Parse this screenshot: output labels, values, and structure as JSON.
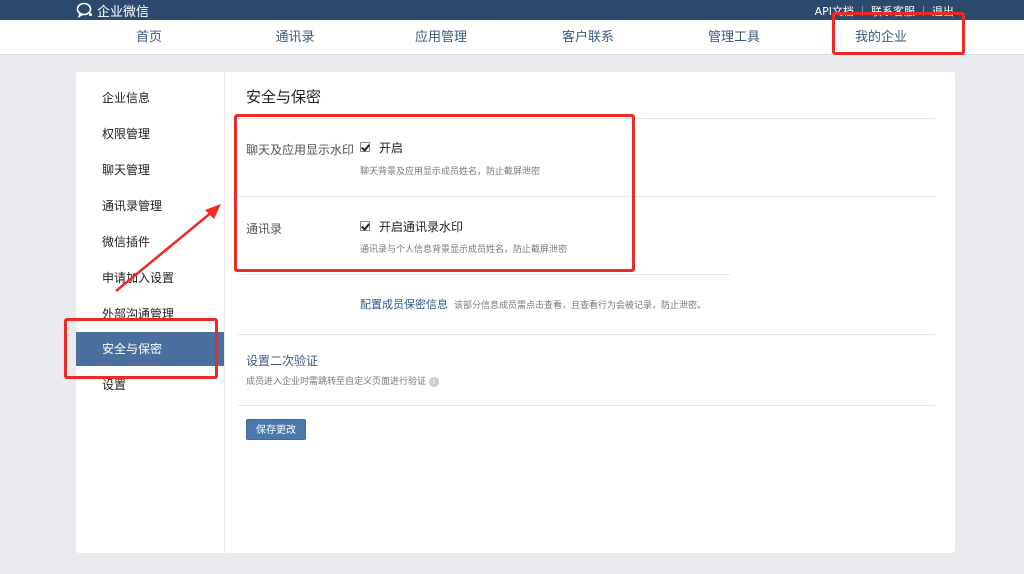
{
  "app": {
    "logo_text": "企业微信"
  },
  "top_links": [
    "API文档",
    "联系客服",
    "退出"
  ],
  "nav": [
    "首页",
    "通讯录",
    "应用管理",
    "客户联系",
    "管理工具",
    "我的企业"
  ],
  "sidebar": [
    "企业信息",
    "权限管理",
    "聊天管理",
    "通讯录管理",
    "微信插件",
    "申请加入设置",
    "外部沟通管理",
    "安全与保密",
    "设置"
  ],
  "sidebar_active": "安全与保密",
  "main": {
    "title": "安全与保密",
    "watermark_chat": {
      "label": "聊天及应用显示水印",
      "option": "开启",
      "checked": true,
      "hint": "聊天背景及应用显示成员姓名，防止截屏泄密"
    },
    "watermark_contacts": {
      "label": "通讯录",
      "option": "开启通讯录水印",
      "checked": true,
      "hint": "通讯录与个人信息背景显示成员姓名，防止截屏泄密"
    },
    "member_secret": {
      "link": "配置成员保密信息",
      "desc": "该部分信息成员需点击查看，且查看行为会被记录，防止泄密。"
    },
    "two_step": {
      "title": "设置二次验证",
      "desc": "成员进入企业时需跳转至自定义页面进行验证"
    },
    "save_label": "保存更改"
  },
  "colors": {
    "topbar": "#2c4a6e",
    "accent": "#4a6f9e",
    "annotation": "#ee2a24"
  }
}
